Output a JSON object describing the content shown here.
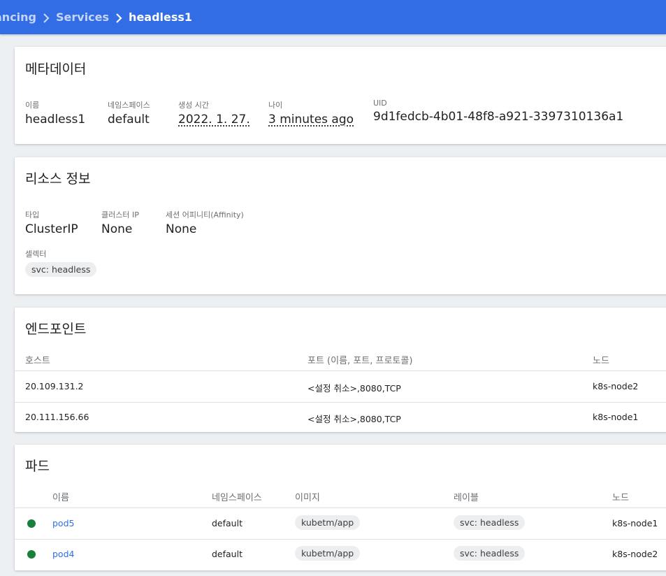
{
  "breadcrumb": {
    "items": [
      "ancing",
      "Services",
      "headless1"
    ]
  },
  "metadata": {
    "title": "메타데이터",
    "name_label": "이름",
    "name_value": "headless1",
    "namespace_label": "네임스페이스",
    "namespace_value": "default",
    "created_label": "생성 시간",
    "created_value": "2022. 1. 27.",
    "age_label": "나이",
    "age_value": "3 minutes ago",
    "uid_label": "UID",
    "uid_value": "9d1fedcb-4b01-48f8-a921-3397310136a1"
  },
  "resource": {
    "title": "리소스 정보",
    "type_label": "타입",
    "type_value": "ClusterIP",
    "cluster_ip_label": "클러스터 IP",
    "cluster_ip_value": "None",
    "affinity_label": "세션 어피니티(Affinity)",
    "affinity_value": "None",
    "selector_label": "셀렉터",
    "selector_chip": "svc: headless"
  },
  "endpoints": {
    "title": "엔드포인트",
    "columns": [
      "호스트",
      "포트 (이름, 포트, 프로토콜)",
      "노드"
    ],
    "rows": [
      {
        "host": "20.109.131.2",
        "ports": "<설정 취소>,8080,TCP",
        "node": "k8s-node2"
      },
      {
        "host": "20.111.156.66",
        "ports": "<설정 취소>,8080,TCP",
        "node": "k8s-node1"
      }
    ]
  },
  "pods": {
    "title": "파드",
    "columns": [
      "이름",
      "네임스페이스",
      "이미지",
      "레이블",
      "노드"
    ],
    "status_color": "#188038",
    "rows": [
      {
        "name": "pod5",
        "namespace": "default",
        "image": "kubetm/app",
        "label": "svc: headless",
        "node": "k8s-node1"
      },
      {
        "name": "pod4",
        "namespace": "default",
        "image": "kubetm/app",
        "label": "svc: headless",
        "node": "k8s-node2"
      }
    ]
  },
  "colors": {
    "header": "#326de6",
    "link": "#326de6",
    "background": "#edf0f2"
  }
}
